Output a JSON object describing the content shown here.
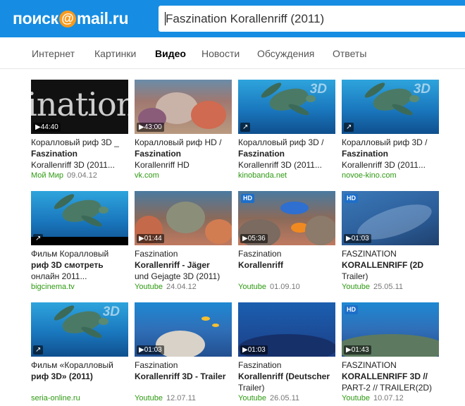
{
  "logo": {
    "before": "поиск",
    "at": "@",
    "after": "mail.ru"
  },
  "search": {
    "value": "Faszination Korallenriff (2011)"
  },
  "tabs": [
    {
      "label": "Интернет",
      "active": false
    },
    {
      "label": "Картинки",
      "active": false
    },
    {
      "label": "Видео",
      "active": true
    },
    {
      "label": "Новости",
      "active": false
    },
    {
      "label": "Обсуждения",
      "active": false
    },
    {
      "label": "Ответы",
      "active": false
    }
  ],
  "results": [
    {
      "duration": "44:40",
      "hd": "",
      "title_lines": [
        "Коралловый риф 3D _",
        "Faszination",
        "Korallenriff 3D (2011..."
      ],
      "source": "Мой Мир",
      "date": "09.04.12",
      "thumb": "titlecard",
      "thumb_text": "ination Koralle"
    },
    {
      "duration": "43:00",
      "hd": "",
      "title_lines": [
        "Коралловый риф HD /",
        "Faszination",
        "Korallenriff HD"
      ],
      "source": "vk.com",
      "date": "",
      "thumb": "reef"
    },
    {
      "duration": "",
      "hd": "",
      "title_lines": [
        "Коралловый риф 3D /",
        "Faszination",
        "Korallenriff 3D (2011..."
      ],
      "source": "kinobanda.net",
      "date": "",
      "thumb": "turtle3d"
    },
    {
      "duration": "",
      "hd": "",
      "title_lines": [
        "Коралловый риф 3D /",
        "Faszination",
        "Korallenriff 3D (2011..."
      ],
      "source": "novoe-kino.com",
      "date": "",
      "thumb": "turtle3d"
    },
    {
      "duration": "",
      "hd": "",
      "title_lines": [
        "Фильм Коралловый",
        "риф 3D смотреть",
        "онлайн 2011..."
      ],
      "source": "bigcinema.tv",
      "date": "",
      "thumb": "turtlebar"
    },
    {
      "duration": "01:44",
      "hd": "",
      "title_lines": [
        "Faszination",
        "Korallenriff - Jäger",
        "und Gejagte 3D (2011)"
      ],
      "source": "Youtube",
      "date": "24.04.12",
      "thumb": "reef2"
    },
    {
      "duration": "05:36",
      "hd": "HD",
      "title_lines": [
        "Faszination",
        "Korallenriff",
        ""
      ],
      "source": "Youtube",
      "date": "01.09.10",
      "thumb": "fish"
    },
    {
      "duration": "01:03",
      "hd": "HD",
      "title_lines": [
        "FASZINATION",
        "KORALLENRIFF (2D",
        "Trailer)"
      ],
      "source": "Youtube",
      "date": "25.05.11",
      "thumb": "shark"
    },
    {
      "duration": "",
      "hd": "",
      "title_lines": [
        "Фильм «Коралловый",
        "риф 3D» (2011)",
        ""
      ],
      "source": "seria-online.ru",
      "date": "",
      "thumb": "turtle3d"
    },
    {
      "duration": "01:03",
      "hd": "",
      "title_lines": [
        "Faszination",
        "Korallenriff 3D - Trailer",
        ""
      ],
      "source": "Youtube",
      "date": "12.07.11",
      "thumb": "fishsea"
    },
    {
      "duration": "01:03",
      "hd": "",
      "title_lines": [
        "Faszination",
        "Korallenriff (Deutscher",
        "Trailer)"
      ],
      "source": "Youtube",
      "date": "26.05.11",
      "thumb": "deep"
    },
    {
      "duration": "01:43",
      "hd": "HD",
      "title_lines": [
        "FASZINATION",
        "KORALLENRIFF 3D //",
        "PART-2 // TRAILER(2D)"
      ],
      "source": "Youtube",
      "date": "10.07.12",
      "thumb": "reefsea"
    }
  ]
}
